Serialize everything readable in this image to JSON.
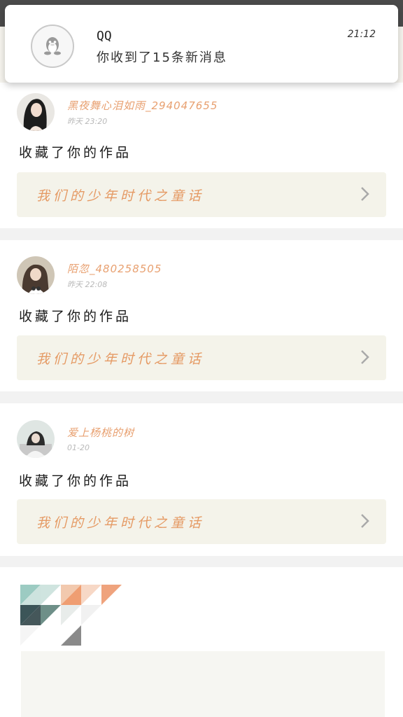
{
  "notification": {
    "app_name": "QQ",
    "message": "你收到了15条新消息",
    "time": "21:12",
    "icon": "qq-penguin-icon"
  },
  "feed": [
    {
      "username": "黑夜舞心泪如雨_294047655",
      "time": "昨天 23:20",
      "action": "收藏了你的作品",
      "work_title": "我们的少年时代之童话"
    },
    {
      "username": "陌忽_480258505",
      "time": "昨天 22:08",
      "action": "收藏了你的作品",
      "work_title": "我们的少年时代之童话"
    },
    {
      "username": "爱上杨桃的树",
      "time": "01-20",
      "action": "收藏了你的作品",
      "work_title": "我们的少年时代之童话"
    }
  ],
  "colors": {
    "accent_orange": "#e59a64",
    "work_bg": "#f4f3ea",
    "separator": "#f2f2f2"
  }
}
